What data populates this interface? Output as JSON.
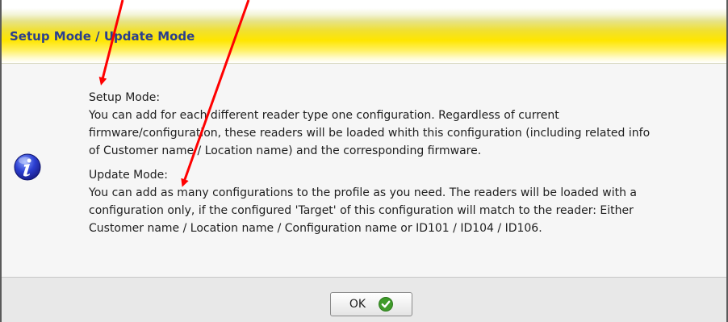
{
  "dialog": {
    "title": "Setup Mode / Update Mode",
    "icon": "info-icon",
    "lines": [
      "Setup Mode:",
      "You can add for each different reader type one configuration. Regardless of current",
      "firmware/configuration, these readers will be loaded whith this configuration (including related info",
      "of Customer name / Location name)  and the corresponding firmware.",
      "Update Mode:",
      "You can add as many configurations to the profile as you need. The readers will be loaded with a",
      "configuration only, if the configured 'Target' of this configuration will match to the reader: Either",
      "Customer name / Location name / Configuration name or ID101 / ID104 / ID106."
    ],
    "ok_label": "OK",
    "ok_icon": "check-icon"
  },
  "colors": {
    "title_text": "#2a3f8f",
    "title_gradient_yellow": "#ffe600",
    "arrow": "#ff0000",
    "check_green": "#3f9b2a"
  }
}
